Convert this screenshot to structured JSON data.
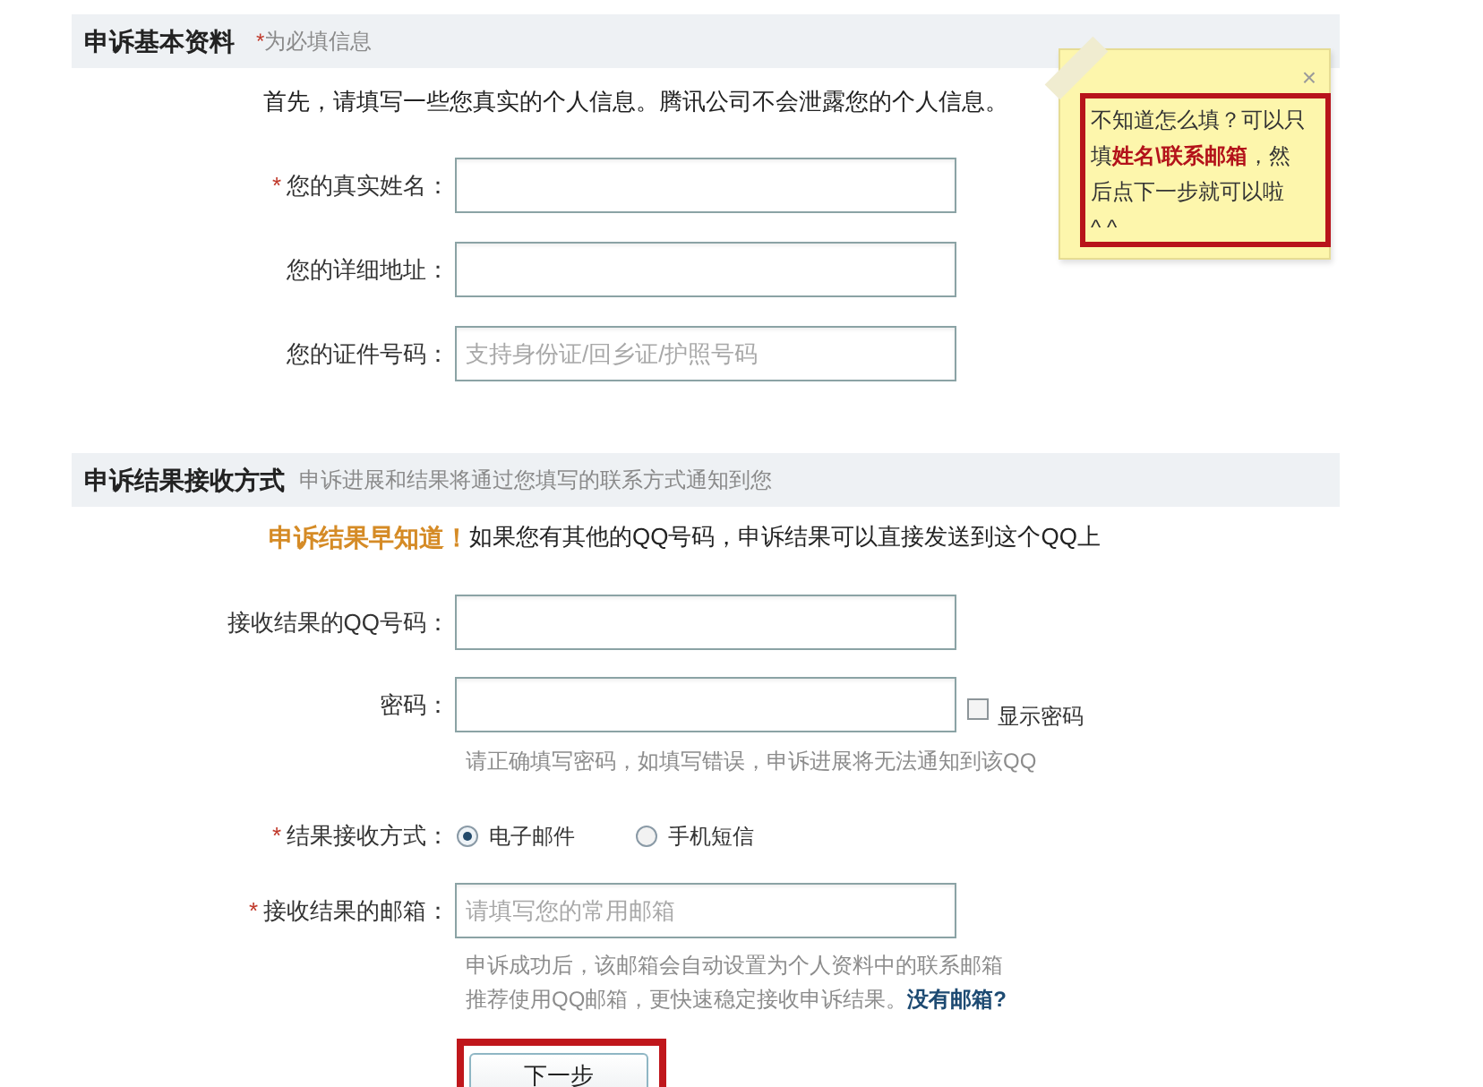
{
  "section_basic": {
    "title": "申诉基本资料",
    "required_mark": "*",
    "hint": "为必填信息"
  },
  "intro": "首先，请填写一些您真实的个人信息。腾讯公司不会泄露您的个人信息。",
  "basic_fields": [
    {
      "required_mark": "*",
      "label": "您的真实姓名："
    },
    {
      "label": "您的详细地址："
    },
    {
      "label": "您的证件号码：",
      "placeholder": "支持身份证/回乡证/护照号码"
    }
  ],
  "section_result": {
    "title": "申诉结果接收方式",
    "hint": "申诉进展和结果将通过您填写的联系方式通知到您"
  },
  "result_tip": {
    "emphasis": "申诉结果早知道！",
    "text": "如果您有其他的QQ号码，申诉结果可以直接发送到这个QQ上"
  },
  "result_fields": [
    {
      "kind": "input",
      "label": "接收结果的QQ号码："
    },
    {
      "kind": "password",
      "label": "密码：",
      "checkbox": {
        "label": "显示密码",
        "checked": false
      },
      "hints": [
        "请正确填写密码，如填写错误，申诉进展将无法通知到该QQ"
      ]
    },
    {
      "kind": "radio",
      "required_mark": "*",
      "label": "结果接收方式：",
      "options": [
        {
          "label": "电子邮件",
          "selected": true
        },
        {
          "label": "手机短信",
          "selected": false
        }
      ]
    },
    {
      "kind": "input",
      "required_mark": "*",
      "label": "接收结果的邮箱：",
      "placeholder": "请填写您的常用邮箱",
      "hints": [
        "申诉成功后，该邮箱会自动设置为个人资料中的联系邮箱",
        "推荐使用QQ邮箱，更快速稳定接收申诉结果。"
      ],
      "link": "没有邮箱?"
    }
  ],
  "submit": {
    "label": "下一步",
    "highlighted": true
  },
  "note": {
    "close": "×",
    "lines": [
      "不知道怎么填？可以只",
      "填**姓名\\联系邮箱**，然",
      "后点下一步就可以啦",
      "^ ^"
    ],
    "highlighted": true
  }
}
